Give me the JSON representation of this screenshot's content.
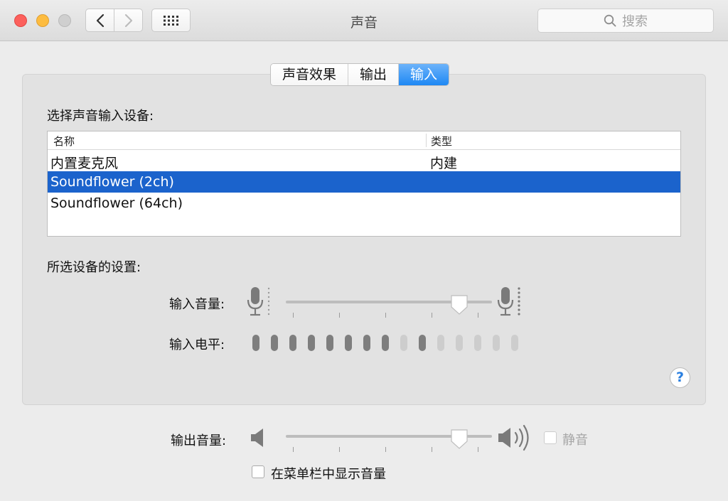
{
  "window": {
    "title": "声音"
  },
  "search": {
    "placeholder": "搜索"
  },
  "tabs": [
    {
      "label": "声音效果",
      "active": false
    },
    {
      "label": "输出",
      "active": false
    },
    {
      "label": "输入",
      "active": true
    }
  ],
  "input_section": {
    "heading": "选择声音输入设备:",
    "table": {
      "columns": [
        "名称",
        "类型"
      ],
      "rows": [
        {
          "name": "内置麦克风",
          "type": "内建",
          "selected": false
        },
        {
          "name": "Soundflower (2ch)",
          "type": "",
          "selected": true
        },
        {
          "name": "Soundflower (64ch)",
          "type": "",
          "selected": false
        }
      ]
    }
  },
  "device_settings": {
    "heading": "所选设备的设置:",
    "input_volume_label": "输入音量:",
    "input_volume": 0.9,
    "input_level_label": "输入电平:",
    "input_level": {
      "segments_total": 15,
      "active_segments": [
        1,
        2,
        3,
        4,
        5,
        6,
        7,
        8,
        10
      ]
    }
  },
  "help": {
    "label": "?"
  },
  "output": {
    "volume_label": "输出音量:",
    "volume": 0.9,
    "mute_label": "静音",
    "mute_checked": false,
    "show_in_menubar_label": "在菜单栏中显示音量",
    "show_in_menubar_checked": false
  },
  "colors": {
    "accent": "#1e88f4",
    "selection": "#1b63cc"
  },
  "icons": [
    "chevron-left-icon",
    "chevron-right-icon",
    "grid-icon",
    "search-icon",
    "microphone-icon",
    "speaker-low-icon",
    "speaker-high-icon"
  ]
}
